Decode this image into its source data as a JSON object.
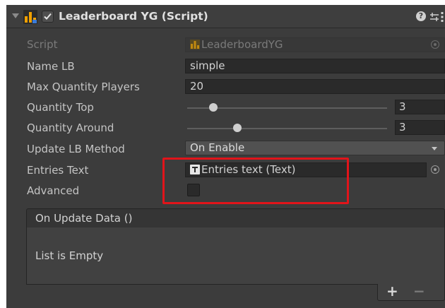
{
  "component": {
    "title": "Leaderboard YG (Script)",
    "enabled": true
  },
  "fields": {
    "script": {
      "label": "Script",
      "value": "LeaderboardYG"
    },
    "name_lb": {
      "label": "Name LB",
      "value": "simple"
    },
    "max_quantity_players": {
      "label": "Max Quantity Players",
      "value": "20"
    },
    "quantity_top": {
      "label": "Quantity Top",
      "value": "3",
      "fraction": 0.13
    },
    "quantity_around": {
      "label": "Quantity Around",
      "value": "3",
      "fraction": 0.25
    },
    "update_lb_method": {
      "label": "Update LB Method",
      "value": "On Enable"
    },
    "entries_text": {
      "label": "Entries Text",
      "value": "Entries text (Text)"
    },
    "advanced": {
      "label": "Advanced",
      "checked": false
    }
  },
  "event": {
    "header": "On Update Data ()",
    "empty_text": "List is Empty",
    "add_label": "+",
    "remove_label": "−"
  },
  "header_buttons": {
    "help": "?"
  },
  "colors": {
    "highlight": "#e1141a",
    "panel_bg": "#3c3c3c",
    "field_bg": "#2a2a2a",
    "script_icon_orange": "#f0a000"
  }
}
